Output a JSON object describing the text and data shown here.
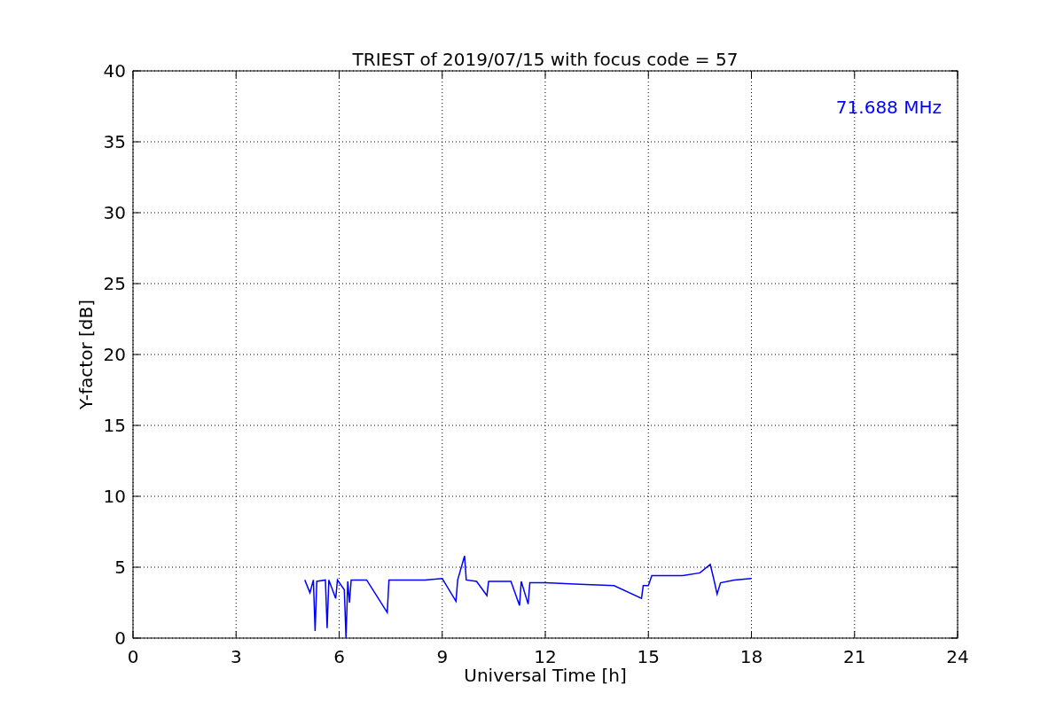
{
  "chart_data": {
    "type": "line",
    "title": "TRIEST of 2019/07/15 with focus code = 57",
    "xlabel": "Universal Time [h]",
    "ylabel": "Y-factor [dB]",
    "x": [
      5.0,
      5.15,
      5.25,
      5.3,
      5.35,
      5.6,
      5.65,
      5.7,
      5.9,
      5.95,
      6.15,
      6.2,
      6.25,
      6.3,
      6.35,
      6.8,
      7.4,
      7.45,
      8.0,
      8.5,
      9.0,
      9.4,
      9.45,
      9.65,
      9.7,
      10.0,
      10.3,
      10.35,
      11.0,
      11.25,
      11.3,
      11.5,
      11.55,
      12.0,
      13.0,
      14.0,
      14.8,
      14.85,
      15.0,
      15.1,
      16.0,
      16.5,
      16.8,
      16.9,
      17.0,
      17.1,
      17.5,
      18.0
    ],
    "series": [
      {
        "name": "71.688 MHz",
        "color": "#0000ff",
        "values": [
          4.1,
          3.2,
          4.1,
          0.5,
          4.0,
          4.1,
          0.7,
          4.1,
          2.8,
          4.1,
          3.4,
          0.0,
          4.0,
          2.5,
          4.1,
          4.1,
          1.8,
          4.1,
          4.1,
          4.1,
          4.2,
          2.6,
          4.1,
          5.8,
          4.1,
          4.0,
          3.0,
          4.0,
          4.0,
          2.3,
          4.0,
          2.4,
          3.9,
          3.9,
          3.8,
          3.7,
          2.8,
          3.7,
          3.7,
          4.4,
          4.4,
          4.6,
          5.2,
          4.2,
          3.1,
          3.9,
          4.1,
          4.2
        ]
      }
    ],
    "xlim": [
      0,
      24
    ],
    "ylim": [
      0,
      40
    ],
    "xticks": [
      0,
      3,
      6,
      9,
      12,
      15,
      18,
      21,
      24
    ],
    "yticks": [
      0,
      5,
      10,
      15,
      20,
      25,
      30,
      35,
      40
    ],
    "grid": true
  }
}
